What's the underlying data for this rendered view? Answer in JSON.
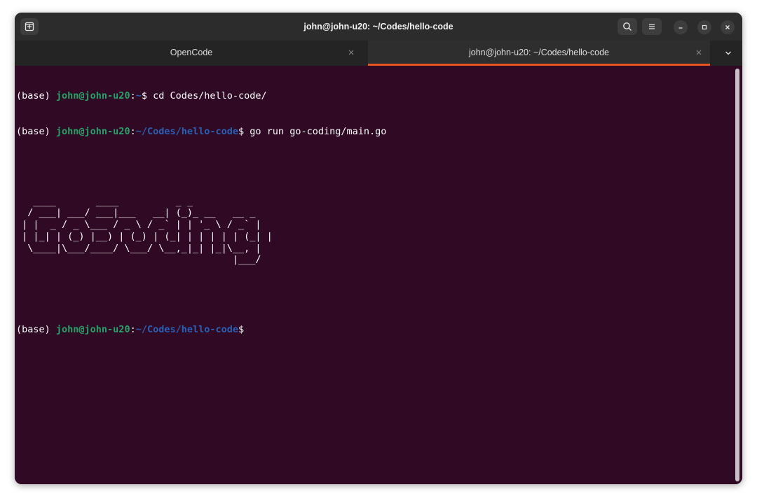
{
  "window": {
    "title": "john@john-u20: ~/Codes/hello-code"
  },
  "tabs": [
    {
      "label": "OpenCode",
      "active": false
    },
    {
      "label": "john@john-u20: ~/Codes/hello-code",
      "active": true
    }
  ],
  "icons": {
    "new_tab": "new-tab-icon",
    "search": "search-icon",
    "menu": "hamburger-menu-icon",
    "minimize": "minimize-icon",
    "maximize": "maximize-icon",
    "close": "close-icon",
    "tab_close": "tab-close-icon",
    "tab_list": "chevron-down-icon"
  },
  "colors": {
    "terminal_bg": "#300a24",
    "prompt_user": "#26a269",
    "prompt_path": "#2a5fb3",
    "tab_accent": "#e95420"
  },
  "terminal": {
    "lines": [
      {
        "env": "(base) ",
        "user": "john@john-u20",
        "sep": ":",
        "path": "~",
        "symbol": "$ ",
        "command": "cd Codes/hello-code/"
      },
      {
        "env": "(base) ",
        "user": "john@john-u20",
        "sep": ":",
        "path": "~/Codes/hello-code",
        "symbol": "$ ",
        "command": "go run go-coding/main.go"
      },
      {
        "env": "(base) ",
        "user": "john@john-u20",
        "sep": ":",
        "path": "~/Codes/hello-code",
        "symbol": "$",
        "command": ""
      }
    ],
    "ascii_art": "   ____       ____          _ _\n  / ___| ___/ ___|___   __| (_)_ __   __ _\n | |  _ / _ \\___ / _ \\ / _` | | '_ \\ / _` |\n | |_| | (_) |__) | (_) | (_| | | | | | (_| |\n  \\____|\\___/____/ \\___/ \\__,_|_| |_|\\__, |\n                                      |___/"
  }
}
